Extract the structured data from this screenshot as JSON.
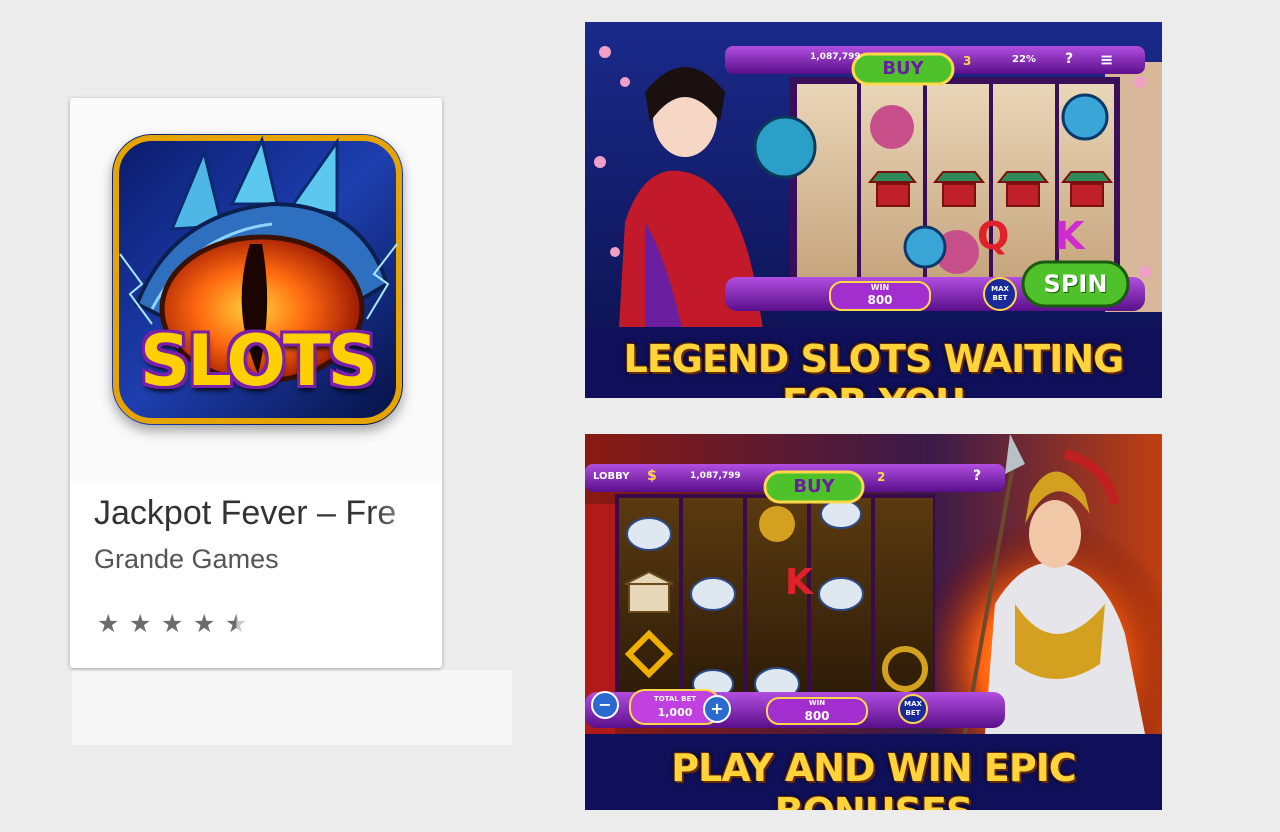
{
  "app_card": {
    "icon_text": "SLOTS",
    "title": "Jackpot Fever – Fre",
    "developer": "Grande Games",
    "rating_stars": 4.5
  },
  "screenshot1": {
    "balance": "1,087,799",
    "buy_label": "BUY",
    "level": "3",
    "percent": "22%",
    "help": "?",
    "win_label": "WIN",
    "win_value": "800",
    "max_bet": "MAX BET",
    "spin_label": "SPIN",
    "caption": "LEGEND SLOTS WAITING FOR YOU",
    "reel_letters": [
      "Q",
      "K"
    ]
  },
  "screenshot2": {
    "lobby_label": "LOBBY",
    "balance": "1,087,799",
    "buy_label": "BUY",
    "level": "2",
    "help": "?",
    "total_bet_label": "TOTAL BET",
    "total_bet_value": "1,000",
    "minus": "−",
    "plus": "+",
    "win_label": "WIN",
    "win_value": "800",
    "max_bet": "MAX BET",
    "reel_letter": "K",
    "caption": "PLAY AND WIN EPIC BONUSES"
  },
  "colors": {
    "star": "#6b6b6b",
    "caption_yellow": "#ffd43a",
    "buy_green": "#4fc22b",
    "purple_frame": "#7a1fa8"
  }
}
